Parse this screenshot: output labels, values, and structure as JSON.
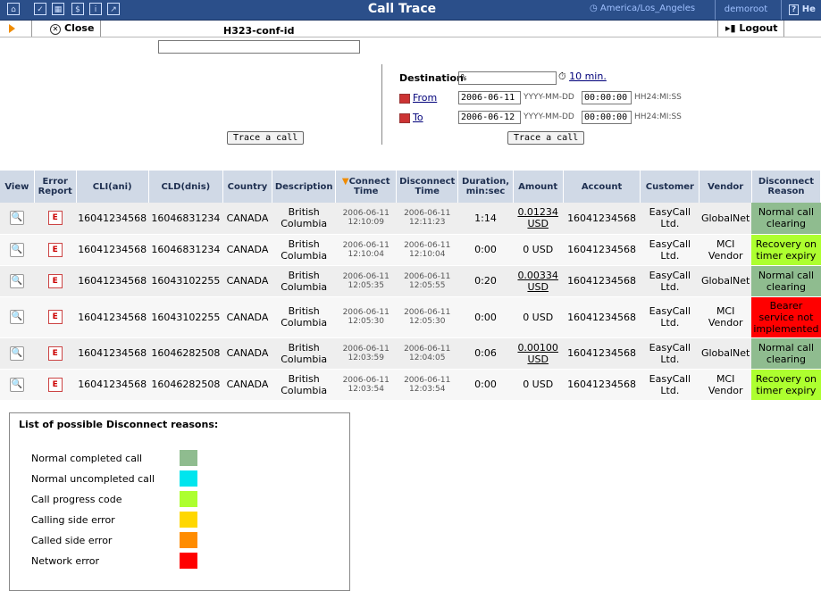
{
  "app": {
    "title": "Call Trace",
    "timezone": "America/Los_Angeles",
    "user": "demoroot",
    "help_label": "He"
  },
  "toolbar": {
    "close_label": "Close",
    "logout_label": "Logout"
  },
  "form": {
    "h323_label": "H323-conf-id",
    "h323_value": "",
    "trace_label": "Trace a call",
    "destination_label": "Destination",
    "destination_value": "%",
    "interval_label": "10 min.",
    "from_label": "From",
    "from_date": "2006-06-11",
    "from_time": "00:00:00",
    "to_label": "To",
    "to_date": "2006-06-12",
    "to_time": "00:00:00",
    "date_hint": "YYYY-MM-DD",
    "time_hint": "HH24:MI:SS"
  },
  "table": {
    "headers": [
      "View",
      "Error Report",
      "CLI(ani)",
      "CLD(dnis)",
      "Country",
      "Description",
      "Connect Time",
      "Disconnect Time",
      "Duration, min:sec",
      "Amount",
      "Account",
      "Customer",
      "Vendor",
      "Disconnect Reason"
    ],
    "rows": [
      {
        "cli": "16041234568",
        "cld": "16046831234",
        "country": "CANADA",
        "desc": "British Columbia",
        "connect": [
          "2006-06-11",
          "12:10:09"
        ],
        "disconnect": [
          "2006-06-11",
          "12:11:23"
        ],
        "duration": "1:14",
        "amount": [
          "0.01234",
          "USD"
        ],
        "account": "16041234568",
        "customer": "EasyCall Ltd.",
        "vendor": "GlobalNet",
        "reason": "Normal call clearing",
        "reason_color": "#8fbc8f"
      },
      {
        "cli": "16041234568",
        "cld": "16046831234",
        "country": "CANADA",
        "desc": "British Columbia",
        "connect": [
          "2006-06-11",
          "12:10:04"
        ],
        "disconnect": [
          "2006-06-11",
          "12:10:04"
        ],
        "duration": "0:00",
        "amount": [
          "0 USD",
          ""
        ],
        "account": "16041234568",
        "customer": "EasyCall Ltd.",
        "vendor": "MCI Vendor",
        "reason": "Recovery on timer expiry",
        "reason_color": "#adff2f"
      },
      {
        "cli": "16041234568",
        "cld": "16043102255",
        "country": "CANADA",
        "desc": "British Columbia",
        "connect": [
          "2006-06-11",
          "12:05:35"
        ],
        "disconnect": [
          "2006-06-11",
          "12:05:55"
        ],
        "duration": "0:20",
        "amount": [
          "0.00334",
          "USD"
        ],
        "account": "16041234568",
        "customer": "EasyCall Ltd.",
        "vendor": "GlobalNet",
        "reason": "Normal call clearing",
        "reason_color": "#8fbc8f"
      },
      {
        "cli": "16041234568",
        "cld": "16043102255",
        "country": "CANADA",
        "desc": "British Columbia",
        "connect": [
          "2006-06-11",
          "12:05:30"
        ],
        "disconnect": [
          "2006-06-11",
          "12:05:30"
        ],
        "duration": "0:00",
        "amount": [
          "0 USD",
          ""
        ],
        "account": "16041234568",
        "customer": "EasyCall Ltd.",
        "vendor": "MCI Vendor",
        "reason": "Bearer service not implemented",
        "reason_color": "#ff0000"
      },
      {
        "cli": "16041234568",
        "cld": "16046282508",
        "country": "CANADA",
        "desc": "British Columbia",
        "connect": [
          "2006-06-11",
          "12:03:59"
        ],
        "disconnect": [
          "2006-06-11",
          "12:04:05"
        ],
        "duration": "0:06",
        "amount": [
          "0.00100",
          "USD"
        ],
        "account": "16041234568",
        "customer": "EasyCall Ltd.",
        "vendor": "GlobalNet",
        "reason": "Normal call clearing",
        "reason_color": "#8fbc8f"
      },
      {
        "cli": "16041234568",
        "cld": "16046282508",
        "country": "CANADA",
        "desc": "British Columbia",
        "connect": [
          "2006-06-11",
          "12:03:54"
        ],
        "disconnect": [
          "2006-06-11",
          "12:03:54"
        ],
        "duration": "0:00",
        "amount": [
          "0 USD",
          ""
        ],
        "account": "16041234568",
        "customer": "EasyCall Ltd.",
        "vendor": "MCI Vendor",
        "reason": "Recovery on timer expiry",
        "reason_color": "#adff2f"
      }
    ]
  },
  "legend": {
    "title": "List of possible Disconnect reasons:",
    "items": [
      {
        "label": "Normal completed call",
        "color": "#8fbc8f"
      },
      {
        "label": "Normal uncompleted call",
        "color": "#00e5ee"
      },
      {
        "label": "Call progress code",
        "color": "#adff2f"
      },
      {
        "label": "Calling side error",
        "color": "#ffd700"
      },
      {
        "label": "Called side error",
        "color": "#ff8c00"
      },
      {
        "label": "Network error",
        "color": "#ff0000"
      }
    ]
  }
}
